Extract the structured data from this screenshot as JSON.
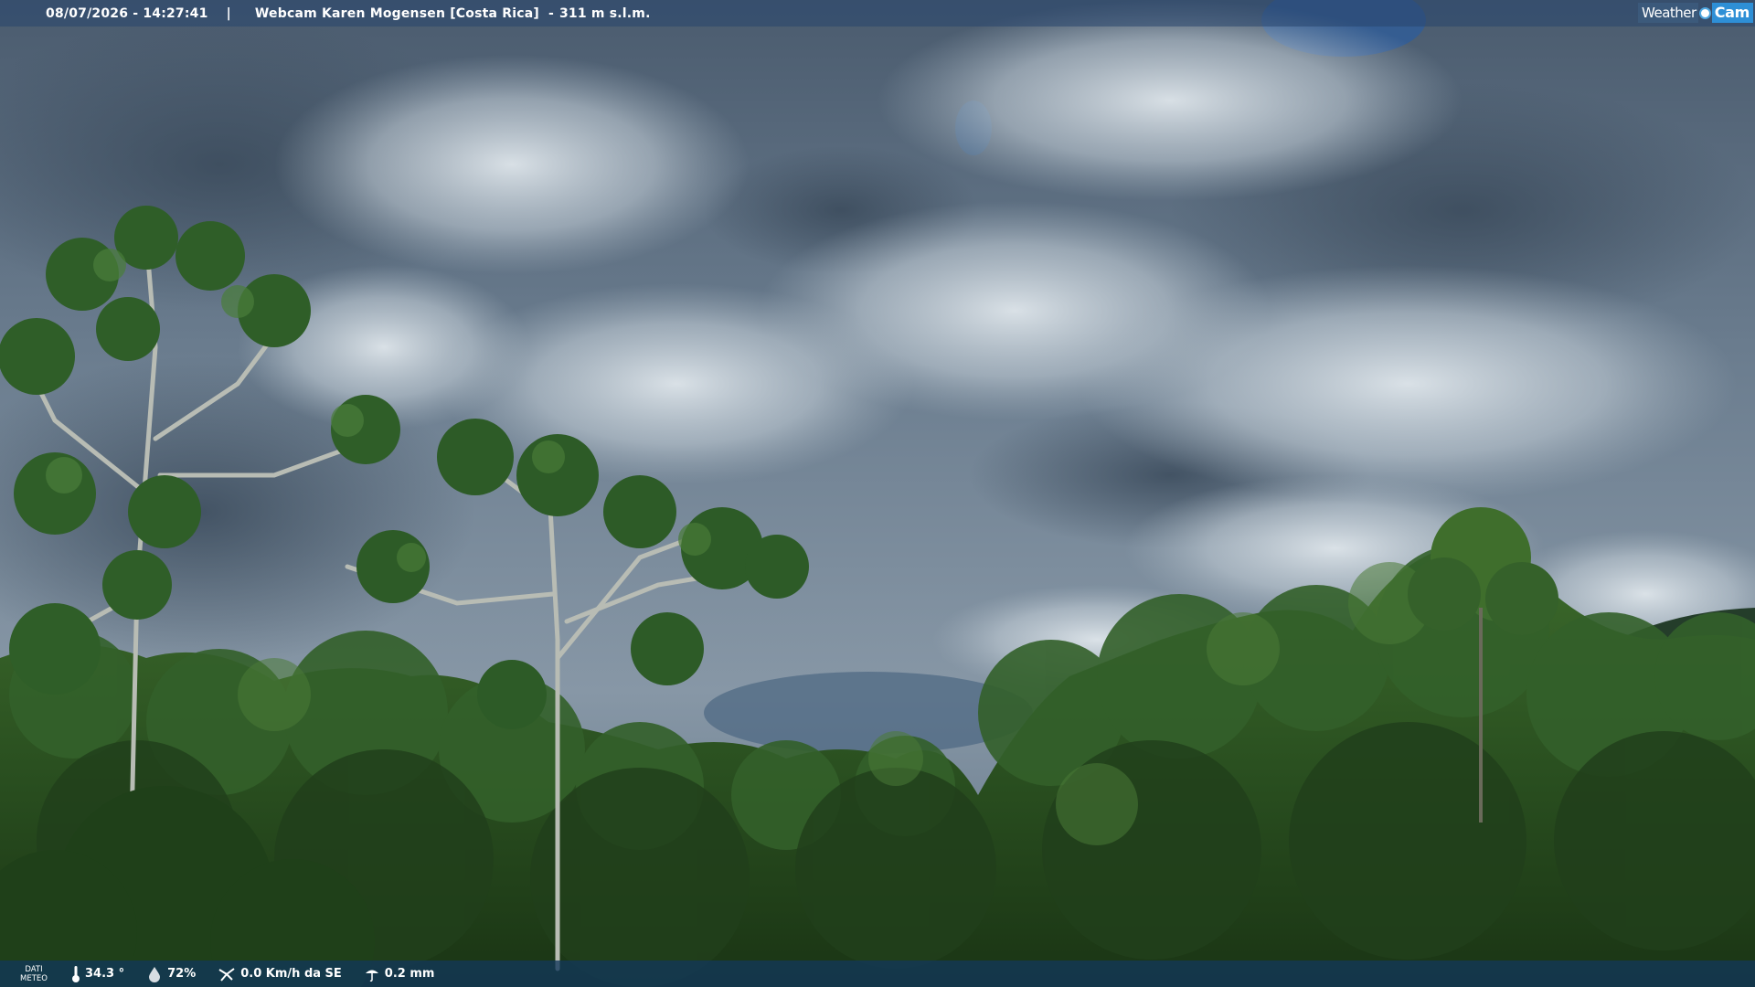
{
  "overlay": {
    "datetime": "08/07/2026 - 14:27:41",
    "separator": "|",
    "station": "Webcam Karen Mogensen [Costa Rica]",
    "dash": "-",
    "altitude": "311 m s.l.m."
  },
  "logo": {
    "part1": "Weather",
    "part2": "Cam"
  },
  "weather": {
    "dati_line1": "DATI",
    "dati_line2": "METEO",
    "temperature": "34.3 °",
    "humidity": "72%",
    "wind": "0.0 Km/h da SE",
    "rain": "0.2 mm"
  },
  "icons": {
    "temperature": "thermometer-icon",
    "humidity": "humidity-drop-icon",
    "wind": "wind-icon",
    "rain": "rain-icon"
  },
  "colors": {
    "sky_dark": "#3f5063",
    "cloud_light": "#c9d4dc",
    "foliage_dark": "#1c3a17",
    "foliage_mid": "#2e5a22",
    "logo_accent": "#2e8fd6"
  }
}
